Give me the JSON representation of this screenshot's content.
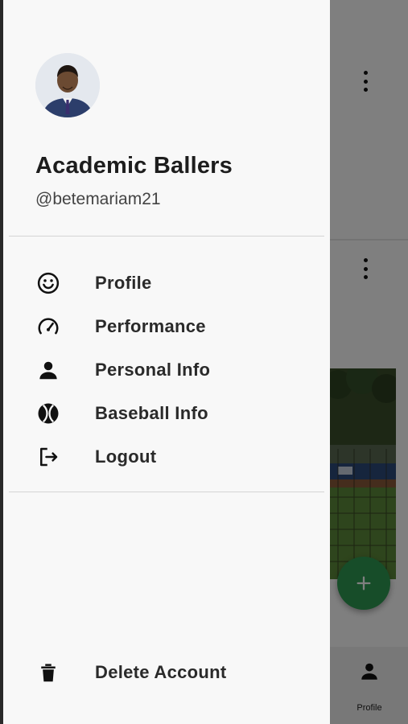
{
  "profile": {
    "name": "Academic Ballers",
    "handle": "@betemariam21"
  },
  "menu": {
    "items": [
      {
        "label": "Profile",
        "icon": "smiley-face-icon"
      },
      {
        "label": "Performance",
        "icon": "speedometer-icon"
      },
      {
        "label": "Personal Info",
        "icon": "person-icon"
      },
      {
        "label": "Baseball Info",
        "icon": "baseball-icon"
      },
      {
        "label": "Logout",
        "icon": "logout-icon"
      }
    ],
    "delete_label": "Delete Account",
    "delete_icon": "trash-icon"
  },
  "bottom_nav": {
    "profile_label": "Profile"
  },
  "colors": {
    "fab": "#2e9a52",
    "drawer_bg": "#f8f8f8",
    "text": "#2a2a2a"
  }
}
